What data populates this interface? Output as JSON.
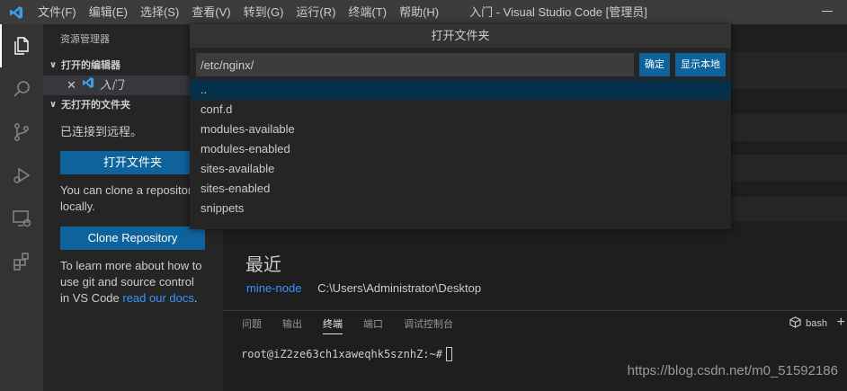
{
  "window": {
    "title": "入门 - Visual Studio Code [管理员]"
  },
  "menu": {
    "items": [
      "文件(F)",
      "编辑(E)",
      "选择(S)",
      "查看(V)",
      "转到(G)",
      "运行(R)",
      "终端(T)",
      "帮助(H)"
    ]
  },
  "sidebar": {
    "title": "资源管理器",
    "open_editors_label": "打开的编辑器",
    "open_editor_item": "入门",
    "no_folder_label": "无打开的文件夹",
    "connected_text": "已连接到远程。",
    "open_folder_button": "打开文件夹",
    "clone_text": "You can clone a repository locally.",
    "clone_button": "Clone Repository",
    "learn_text": "To learn more about how to use git and source control in VS Code ",
    "learn_link": "read our docs",
    "learn_end": "."
  },
  "quickpick": {
    "title": "打开文件夹",
    "input_value": "/etc/nginx/",
    "ok_button": "确定",
    "show_local_button": "显示本地",
    "items": [
      "..",
      "conf.d",
      "modules-available",
      "modules-enabled",
      "sites-available",
      "sites-enabled",
      "snippets"
    ]
  },
  "editor": {
    "recent_title": "最近",
    "recent": [
      {
        "name": "mine-node",
        "path": "C:\\Users\\Administrator\\Desktop"
      }
    ]
  },
  "panel": {
    "tabs": [
      "问题",
      "输出",
      "终端",
      "端口",
      "调试控制台"
    ],
    "active_tab": "终端",
    "terminal_select": "bash",
    "terminal_prompt": "root@iZ2ze63ch1xaweqhk5sznhZ:~#"
  },
  "watermark": "https://blog.csdn.net/m0_51592186",
  "colors": {
    "accent": "#0e639c",
    "link": "#3794ff",
    "activity_bar": "#333333",
    "sidebar": "#252526",
    "editor": "#1e1e1e"
  }
}
